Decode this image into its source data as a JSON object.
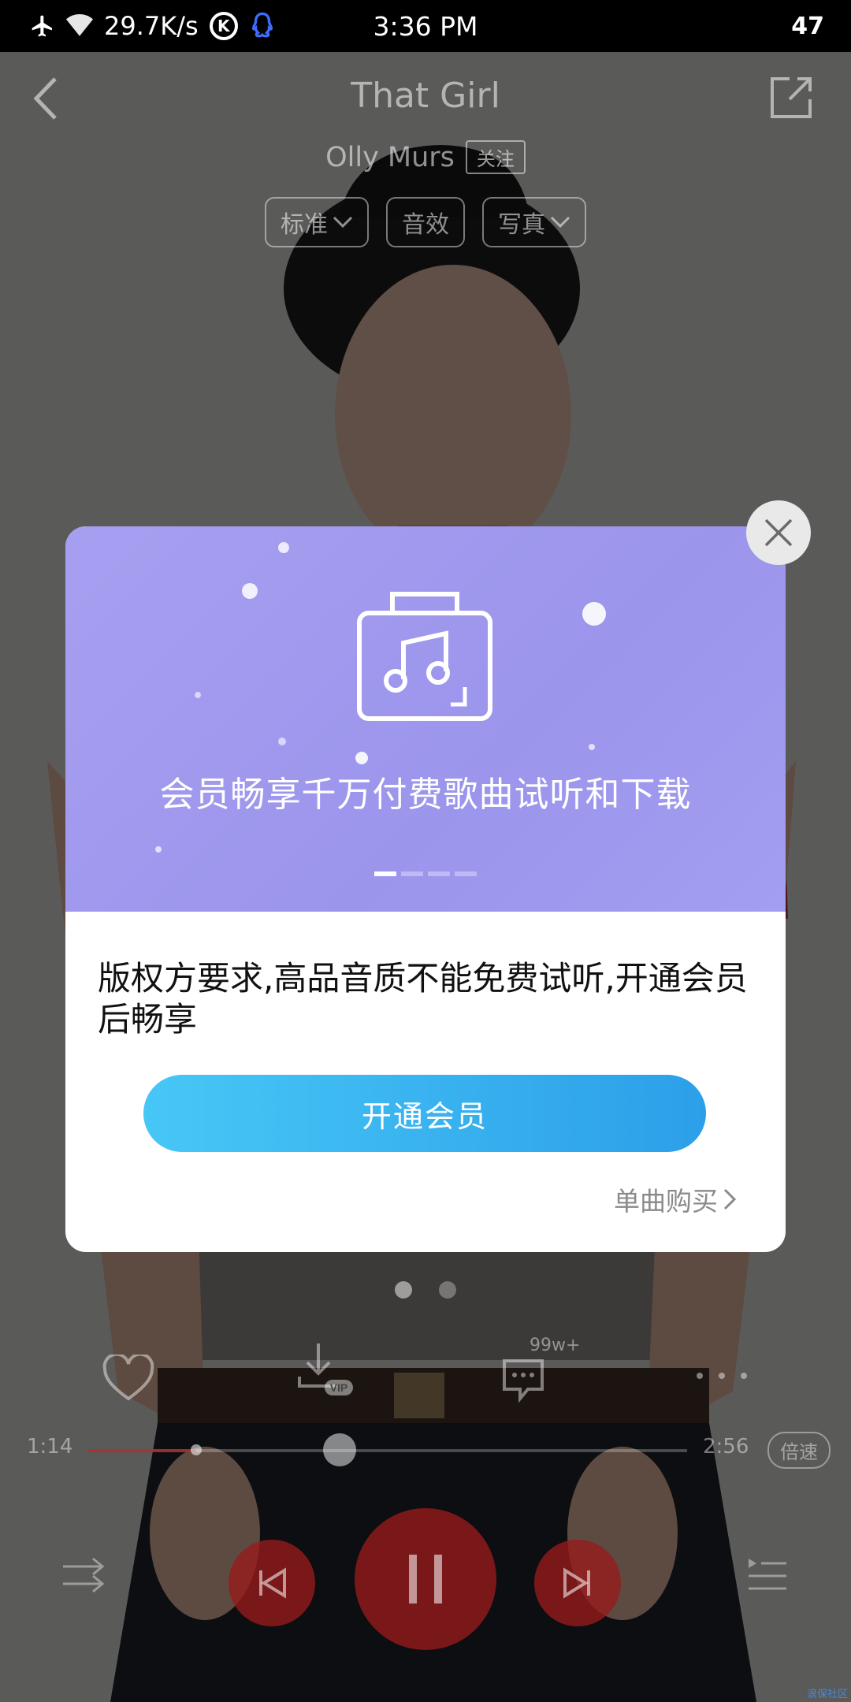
{
  "status_bar": {
    "net_speed": "29.7K/s",
    "k_badge": "K",
    "time": "3:36 PM",
    "battery": "47"
  },
  "player": {
    "title": "That Girl",
    "artist": "Olly Murs",
    "follow_label": "关注",
    "chips": [
      "标准",
      "音效",
      "写真"
    ],
    "comment_count": "99w+",
    "vip_tag": "VIP",
    "time_elapsed": "1:14",
    "time_total": "2:56",
    "progress_fraction": 0.42,
    "buffer_fraction": 0.18,
    "speed_label": "倍速",
    "more_icon": "more-dots-icon"
  },
  "modal": {
    "hero_text": "会员畅享千万付费歌曲试听和下载",
    "carousel_count": 4,
    "carousel_active": 0,
    "message": "版权方要求,高品音质不能免费试听,开通会员后畅享",
    "primary_button": "开通会员",
    "secondary_link": "单曲购买",
    "accent_gradient": [
      "#47c7f6",
      "#2c9fe9"
    ],
    "hero_color": "#a09aee"
  },
  "watermark": "浪保社区"
}
